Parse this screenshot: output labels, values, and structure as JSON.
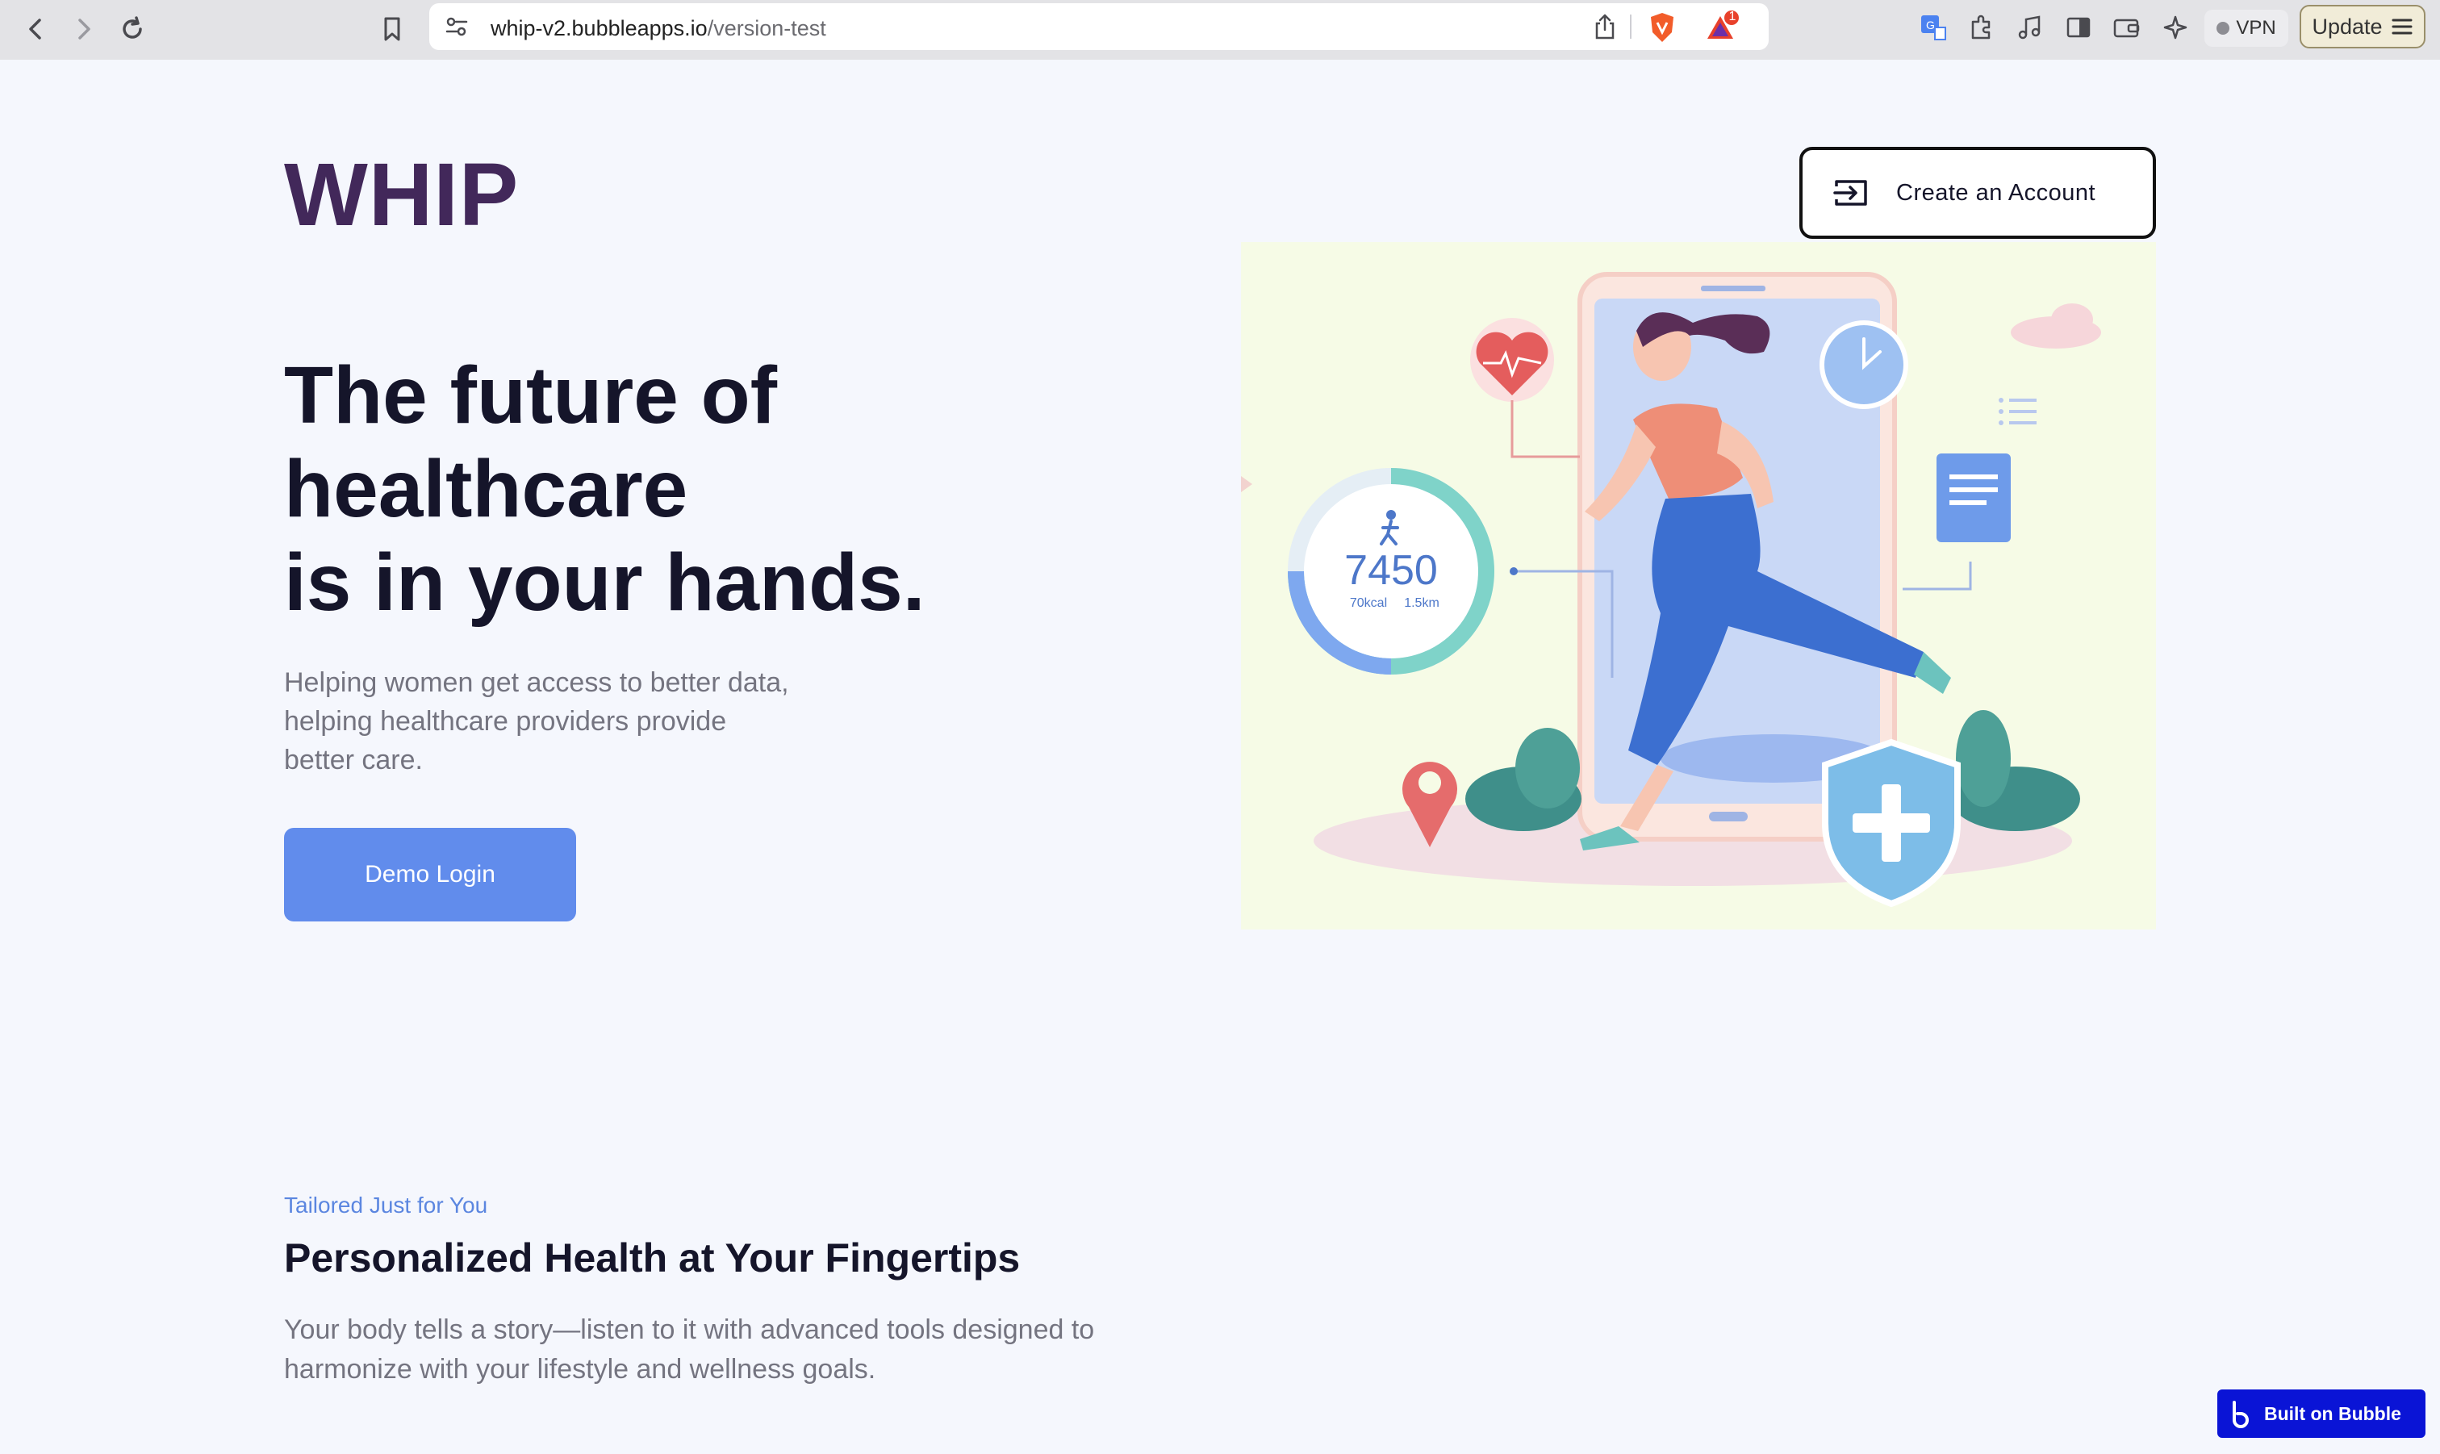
{
  "browser": {
    "url_domain": "whip-v2.bubbleapps.io",
    "url_path": "/version-test",
    "brave_badge": "1",
    "vpn_label": "VPN",
    "update_label": "Update"
  },
  "header": {
    "logo": "WHIP",
    "create_account": "Create an Account"
  },
  "hero": {
    "title_lines": [
      "The future of",
      "healthcare",
      "is in your hands."
    ],
    "subtitle_lines": [
      "Helping women get access to better data,",
      "helping healthcare providers provide",
      "better care."
    ],
    "demo_login": "Demo Login",
    "illustration": {
      "steps": "7450",
      "kcal": "70kcal",
      "distance": "1.5km"
    }
  },
  "section": {
    "eyebrow": "Tailored Just for You",
    "title": "Personalized Health at Your Fingertips",
    "body_lines": [
      "Your body tells a story—listen to it with advanced tools designed to",
      "harmonize with your lifestyle and wellness goals."
    ]
  },
  "badge": {
    "label": "Built on Bubble"
  },
  "colors": {
    "logo": "#42285a",
    "primary_button": "#618cec",
    "eyebrow": "#5b86e0",
    "page_bg": "#f5f7fd",
    "bubble_badge": "#0a14d6"
  }
}
